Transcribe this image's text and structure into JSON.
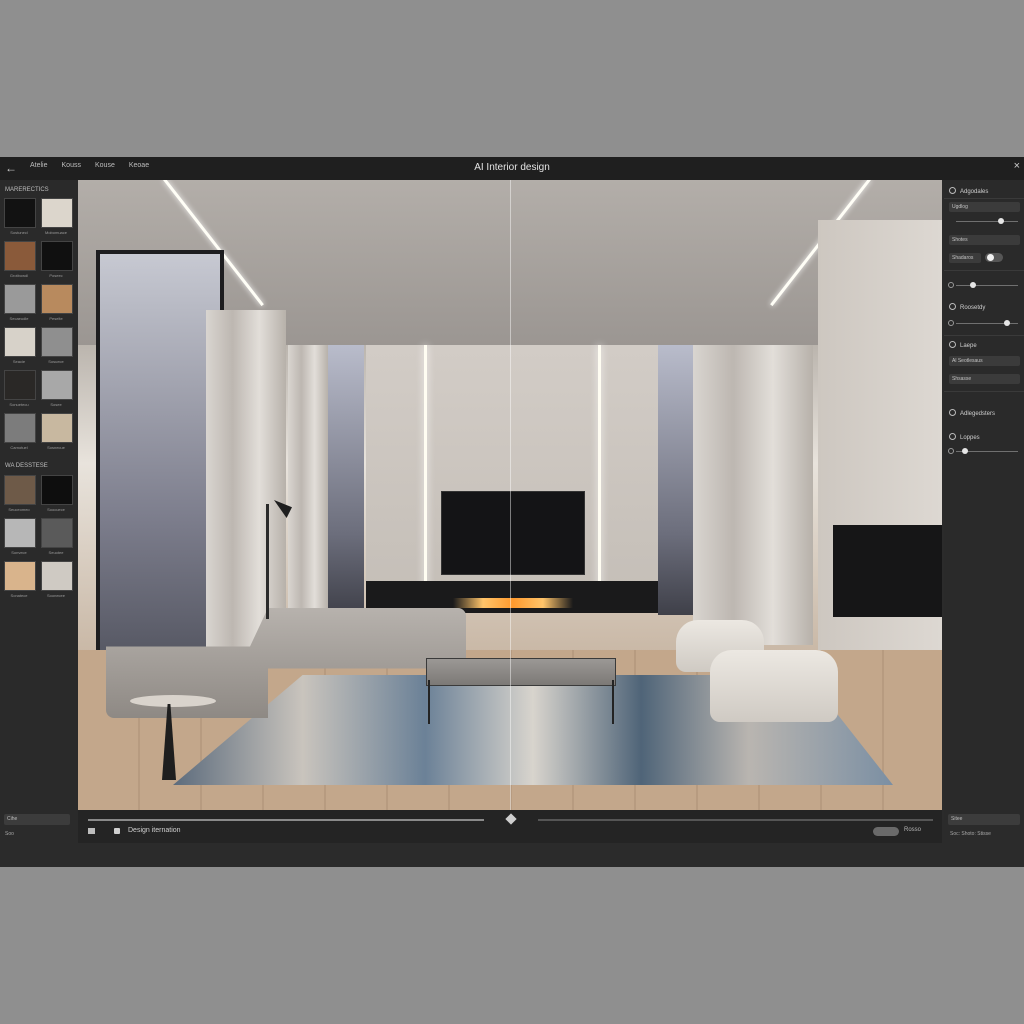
{
  "app": {
    "title": "AI Interior design"
  },
  "menu": [
    "Atelie",
    "Kouss",
    "Kouse",
    "Keoae"
  ],
  "library": {
    "sections": [
      {
        "title": "Marerectics",
        "tiles": [
          {
            "label": "Sostunecl",
            "color": "#121212"
          },
          {
            "label": "Mobomuace",
            "color": "#dcd6cc"
          },
          {
            "label": "Grotbowdl",
            "color": "#8a5a3a"
          },
          {
            "label": "Poseec",
            "color": "#101010"
          },
          {
            "label": "Secaeudle",
            "color": "#9a9a9a"
          },
          {
            "label": "Peselte",
            "color": "#b88a5e"
          },
          {
            "label": "Seacie",
            "color": "#d7d2c9"
          },
          {
            "label": "Sosuece",
            "color": "#8f8f8f"
          },
          {
            "label": "Sonuetecu",
            "color": "#2a2826"
          },
          {
            "label": "Sosee",
            "color": "#a8a8a8"
          },
          {
            "label": "Carnotuel",
            "color": "#7c7c7c"
          },
          {
            "label": "Sosnecue",
            "color": "#c8b8a0"
          }
        ]
      },
      {
        "title": "Wa Desstese",
        "tiles": [
          {
            "label": "Seuceomeo",
            "color": "#6e5a48"
          },
          {
            "label": "Soocuece",
            "color": "#0e0e0e"
          },
          {
            "label": "Sonvece",
            "color": "#b7b7b7"
          },
          {
            "label": "Seuotee",
            "color": "#5a5a5a"
          },
          {
            "label": "Sonatece",
            "color": "#d9b48c"
          },
          {
            "label": "Soonecee",
            "color": "#cfcac3"
          }
        ]
      }
    ],
    "footer_input": "Cihe",
    "footer_text": "Soo"
  },
  "canvas": {
    "divider": true
  },
  "bottom_bar": {
    "label": "Design iternation",
    "pill_label": "Rosso"
  },
  "right_panel": {
    "header": "Adgodales",
    "item1": "Ugdlog",
    "field1": "Shotes",
    "field2": "Shadaros",
    "item2": "Roosetdy",
    "item3": "Laepe",
    "field3": "Al Seotlesaus",
    "field4": "Shsasse",
    "item4": "Adlegedsters",
    "item5": "Loppes",
    "footer_input": "Sitee",
    "footer_text": "Soc: Shoto: Stisse"
  },
  "slider_levels": {
    "s1": 0.75,
    "s2": 0.25,
    "s3": 0.85,
    "s4": 0.1
  }
}
